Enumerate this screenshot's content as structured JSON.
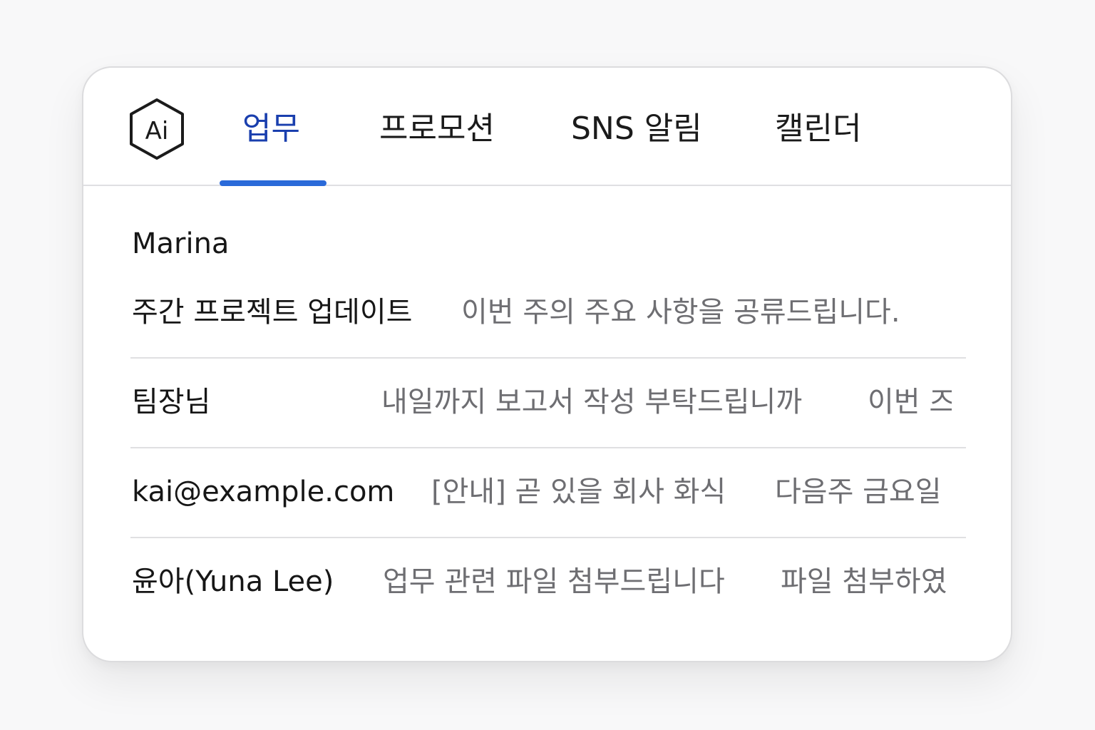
{
  "logo": {
    "text": "Ai",
    "icon": "ai-hexagon-logo-icon"
  },
  "tabs": [
    {
      "label": "업무",
      "active": true
    },
    {
      "label": "프로모션",
      "active": false
    },
    {
      "label": "SNS 알림",
      "active": false
    },
    {
      "label": "캘린더",
      "active": false
    }
  ],
  "colors": {
    "accent": "#2a6ad9",
    "active_tab_text": "#1a3fae",
    "primary_text": "#161616",
    "secondary_text": "#6e6e72",
    "divider": "#e0e0e2",
    "card_background": "#ffffff",
    "page_background": "#f8f8f9"
  },
  "messages": [
    {
      "sender": "Marina",
      "subject": "주간 프로젝트 업데이트",
      "preview": "이번 주의 주요 사항을 공류드립니다."
    },
    {
      "sender": "팀장님",
      "subject": "내일까지 보고서 작성 부탁드립니까",
      "preview": "이번 즈"
    },
    {
      "sender": "kai@example.com",
      "subject": "[안내] 곧 있을 회사 화식",
      "preview": "다음주 금요일"
    },
    {
      "sender": "윤아(Yuna Lee)",
      "subject": "업무 관련 파일 첨부드립니다",
      "preview": "파일 첨부하였"
    }
  ]
}
